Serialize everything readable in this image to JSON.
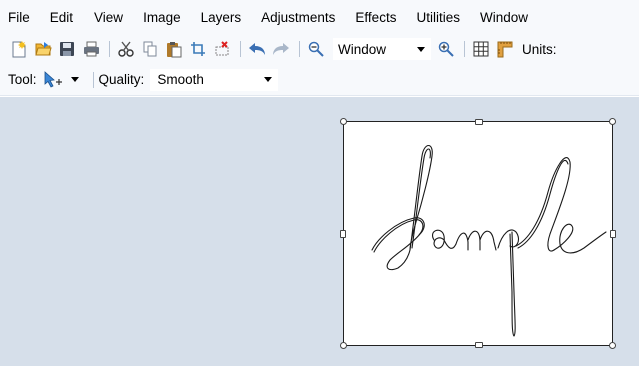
{
  "menu": {
    "items": [
      "File",
      "Edit",
      "View",
      "Image",
      "Layers",
      "Adjustments",
      "Effects",
      "Utilities",
      "Window"
    ]
  },
  "toolbar": {
    "zoom_value": "Window",
    "units_label": "Units:"
  },
  "tool_bar": {
    "tool_label": "Tool:",
    "quality_label": "Quality:",
    "quality_value": "Smooth"
  },
  "canvas": {
    "background_color": "#d6dfea",
    "signature_text": "Sample"
  }
}
